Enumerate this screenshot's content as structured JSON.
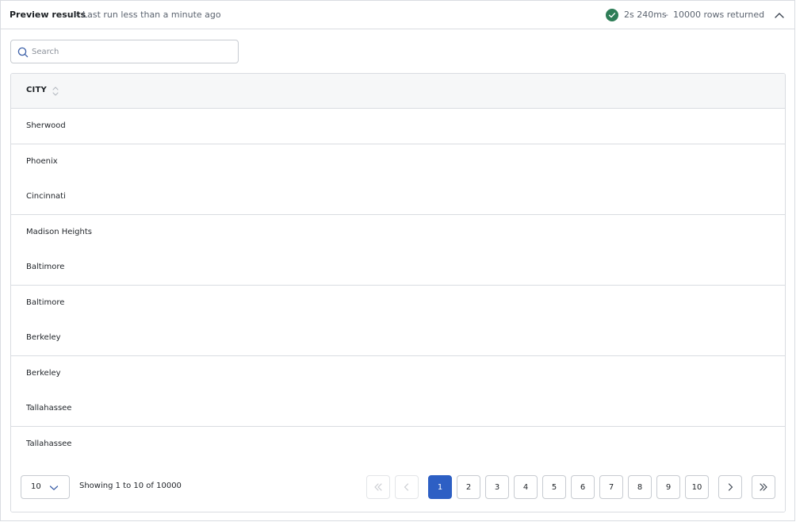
{
  "header": {
    "title": "Preview results",
    "separator": "-",
    "subtitle": "Last run less than a minute ago",
    "duration": "2s 240ms",
    "rows_returned": "10000 rows returned",
    "status_color": "#2e7d57"
  },
  "search": {
    "placeholder": "Search",
    "value": ""
  },
  "table": {
    "column_header": "CITY",
    "rows": [
      "Sherwood",
      "Phoenix",
      "Cincinnati",
      "Madison Heights",
      "Baltimore",
      "Baltimore",
      "Berkeley",
      "Berkeley",
      "Tallahassee",
      "Tallahassee"
    ]
  },
  "pagination": {
    "page_size": "10",
    "showing": "Showing 1 to 10 of 10000",
    "pages": [
      "1",
      "2",
      "3",
      "4",
      "5",
      "6",
      "7",
      "8",
      "9",
      "10"
    ],
    "current_page": "1",
    "accent_color": "#2d5fc4"
  }
}
